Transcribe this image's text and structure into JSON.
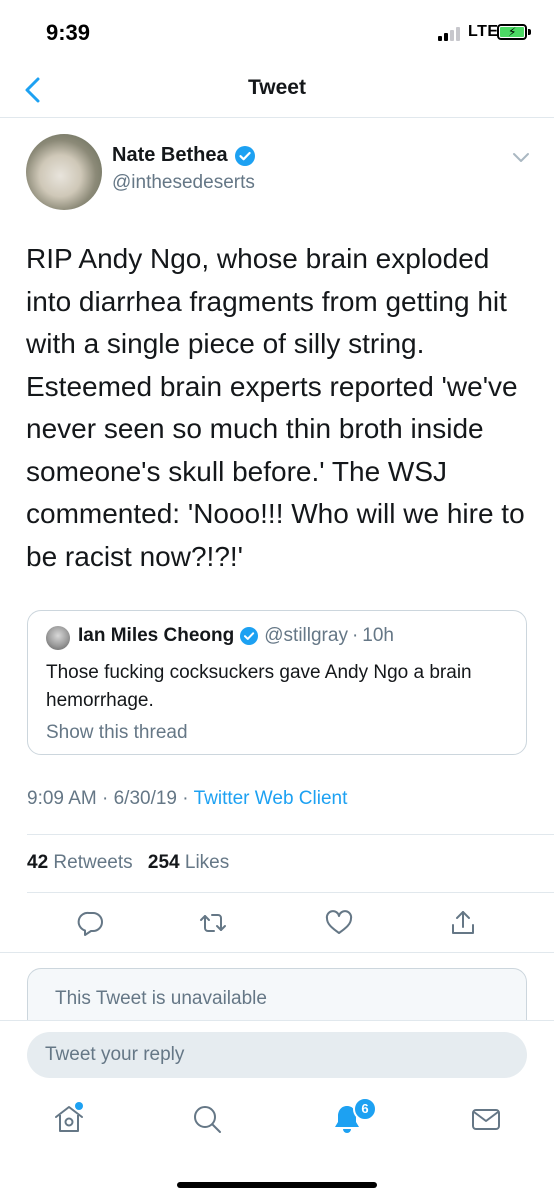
{
  "status_bar": {
    "time": "9:39",
    "network": "LTE"
  },
  "nav": {
    "title": "Tweet"
  },
  "tweet": {
    "display_name": "Nate Bethea",
    "handle": "@inthesedeserts",
    "text": "RIP Andy Ngo, whose brain exploded into diarrhea fragments from getting hit with a single piece of silly string. Esteemed brain experts reported 'we've never seen so much thin broth inside someone's skull before.' The WSJ commented: 'Nooo!!! Who will we hire to be racist now?!?!'",
    "time": "9:09 AM",
    "date": "6/30/19",
    "client": "Twitter Web Client",
    "retweets_count": "42",
    "retweets_label": "Retweets",
    "likes_count": "254",
    "likes_label": "Likes"
  },
  "quoted_tweet": {
    "display_name": "Ian Miles Cheong",
    "handle": "@stillgray",
    "separator": "·",
    "time": "10h",
    "text": "Those fucking cocksuckers gave Andy Ngo a brain hemorrhage.",
    "show_thread": "Show this thread"
  },
  "unavailable": {
    "text": "This Tweet is unavailable"
  },
  "reply": {
    "placeholder": "Tweet your reply"
  },
  "tabbar": {
    "notification_badge": "6",
    "items": [
      "home-icon",
      "search-icon",
      "notifications-icon",
      "messages-icon"
    ]
  },
  "colors": {
    "accent": "#1da1f2",
    "secondary_text": "#657786",
    "battery": "#4cd964"
  }
}
